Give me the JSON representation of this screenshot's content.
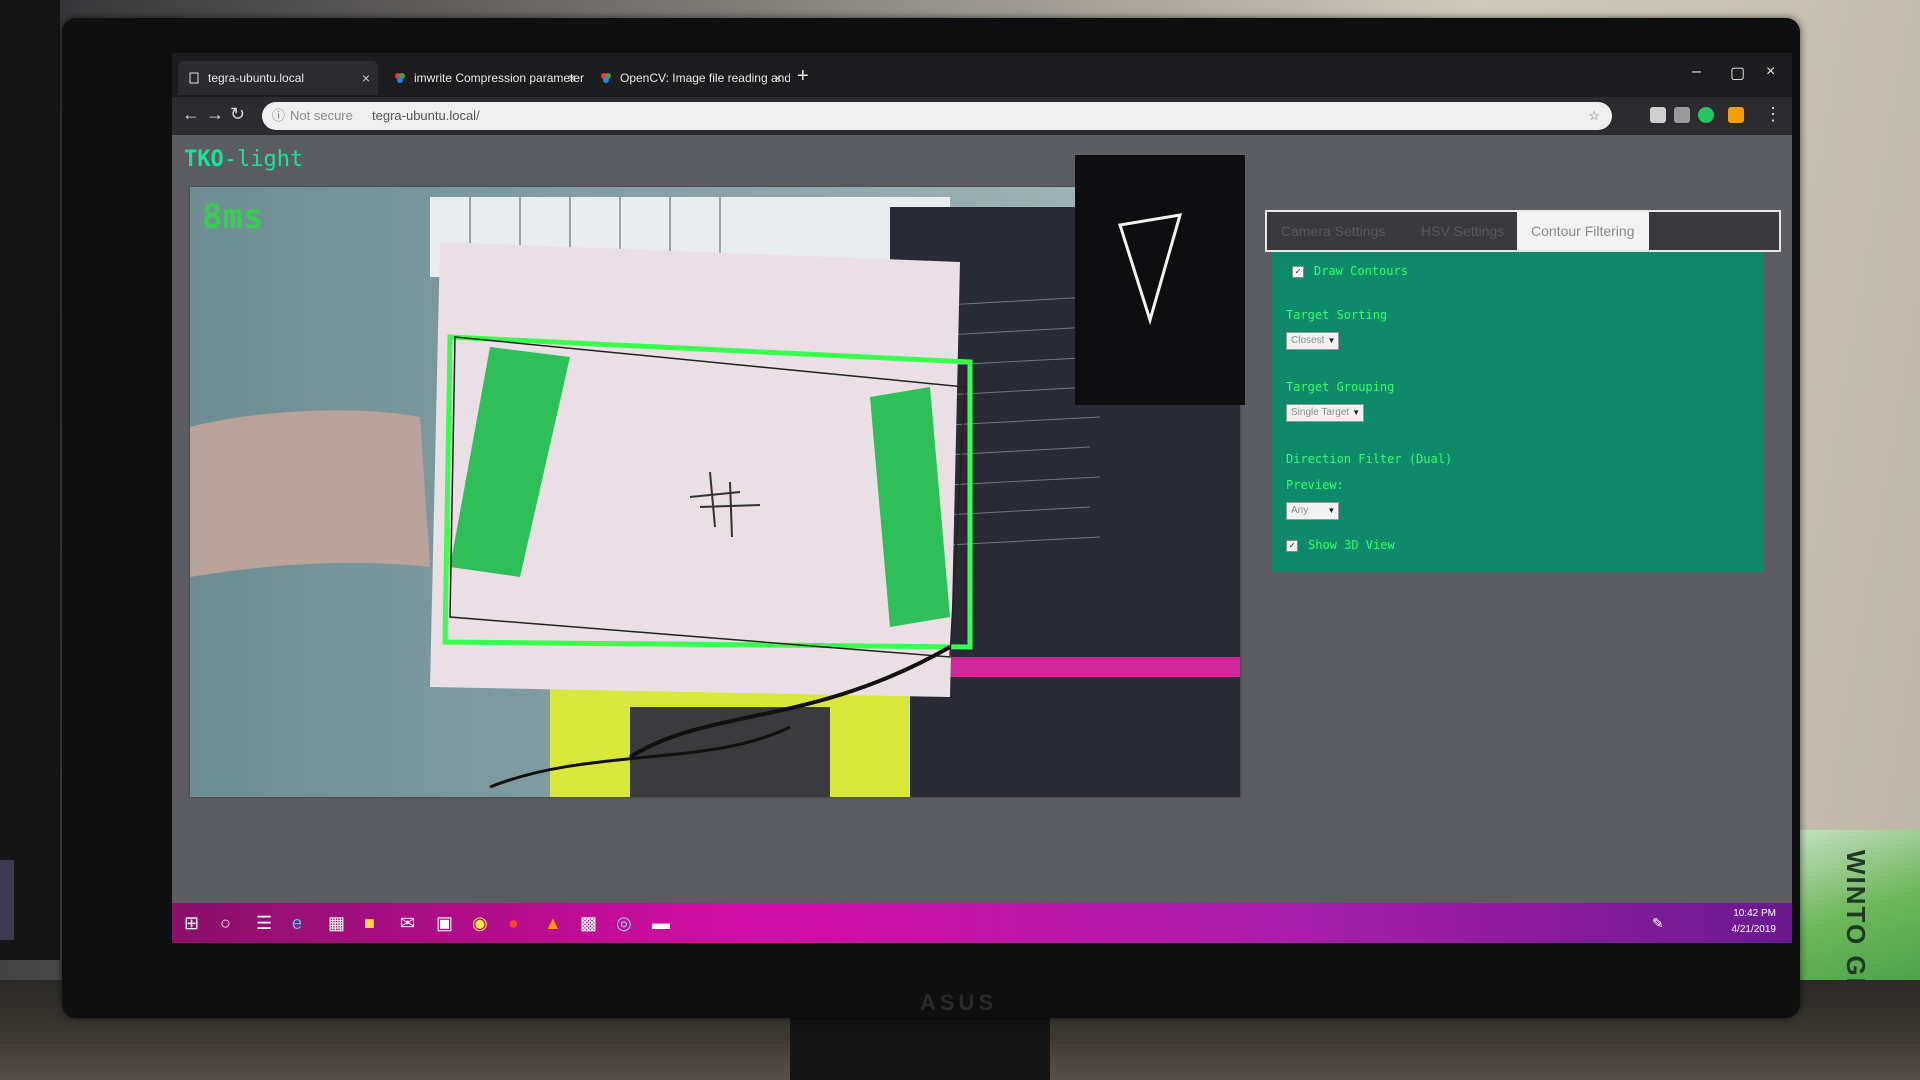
{
  "browser": {
    "tabs": [
      {
        "title": "tegra-ubuntu.local",
        "active": true
      },
      {
        "title": "imwrite Compression parameter",
        "active": false
      },
      {
        "title": "OpenCV: Image file reading and",
        "active": false
      }
    ],
    "new_tab": "+",
    "close_glyph": "×",
    "address": {
      "security": "Not secure",
      "url": "tegra-ubuntu.local/"
    },
    "window_controls": {
      "minimize": "–",
      "maximize": "▢",
      "close": "×"
    }
  },
  "app": {
    "logo_part1": "TKO",
    "logo_part2": "-light",
    "camera_fps": "8ms"
  },
  "settings": {
    "tabs": [
      {
        "label": "Camera Settings",
        "active": false
      },
      {
        "label": "HSV Settings",
        "active": false
      },
      {
        "label": "Contour Filtering",
        "active": true
      }
    ],
    "draw_contours": {
      "label": "Draw Contours",
      "checked": true
    },
    "target_sorting": {
      "label": "Target Sorting",
      "value": "Closest"
    },
    "target_grouping": {
      "label": "Target Grouping",
      "value": "Single Target"
    },
    "direction_filter": {
      "label": "Direction Filter (Dual)",
      "preview_label": "Preview:",
      "value": "Any"
    },
    "show_3d": {
      "label": "Show 3D View",
      "checked": true
    }
  },
  "taskbar": {
    "time": "10:42 PM",
    "date": "4/21/2019"
  },
  "monitor_brand": "ASUS",
  "background_text": "WINTO GREEN",
  "colors": {
    "panel_bg": "#0e8a6a",
    "panel_text": "#30ff6a",
    "logo": "#19e39a",
    "contour_green": "#39ff4e",
    "taskbar_magenta": "#d20ea5"
  }
}
